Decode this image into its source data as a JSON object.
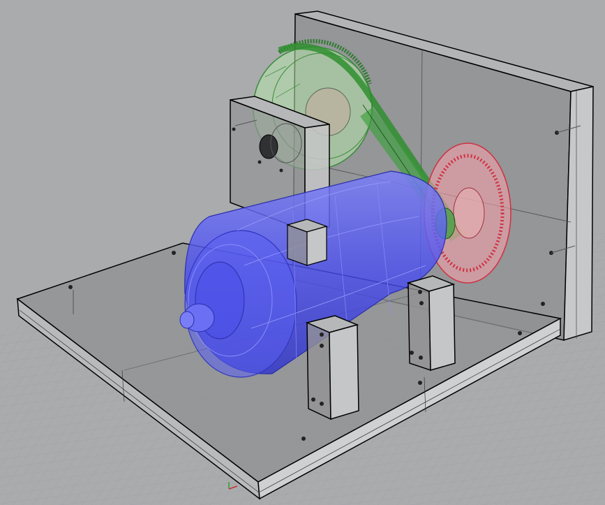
{
  "viewport": {
    "background": "#a9abad",
    "grid_color": "#9da1a5",
    "axis_x_color": "#c83232",
    "axis_y_color": "#32a032"
  },
  "model": {
    "parts": [
      {
        "name": "base-plate",
        "color": "#8f9092"
      },
      {
        "name": "back-plate",
        "color": "#8f9092"
      },
      {
        "name": "motor",
        "color": "#4a4ef0"
      },
      {
        "name": "large-pulley",
        "color": "#a8e0a0"
      },
      {
        "name": "small-pulley",
        "color": "#f06878"
      },
      {
        "name": "belt",
        "color": "#3aa03a"
      },
      {
        "name": "bearing-block",
        "color": "#8f9092"
      },
      {
        "name": "motor-mount",
        "color": "#8f9092"
      }
    ]
  }
}
